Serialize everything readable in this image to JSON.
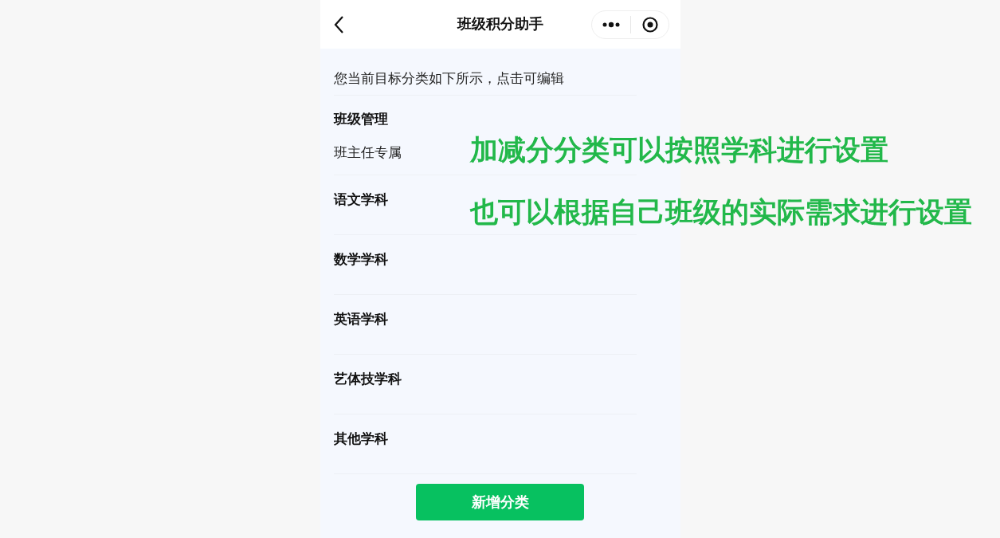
{
  "nav_bar": {
    "title": "班级积分助手"
  },
  "intro": "您当前目标分类如下所示，点击可编辑",
  "categories": [
    {
      "name": "班级管理",
      "subtitle": "班主任专属"
    },
    {
      "name": "语文学科"
    },
    {
      "name": "数学学科"
    },
    {
      "name": "英语学科"
    },
    {
      "name": "艺体技学科"
    },
    {
      "name": "其他学科"
    }
  ],
  "add_button": "新增分类",
  "annotations": [
    "加减分分类可以按照学科进行设置",
    "也可以根据自己班级的实际需求进行设置"
  ]
}
